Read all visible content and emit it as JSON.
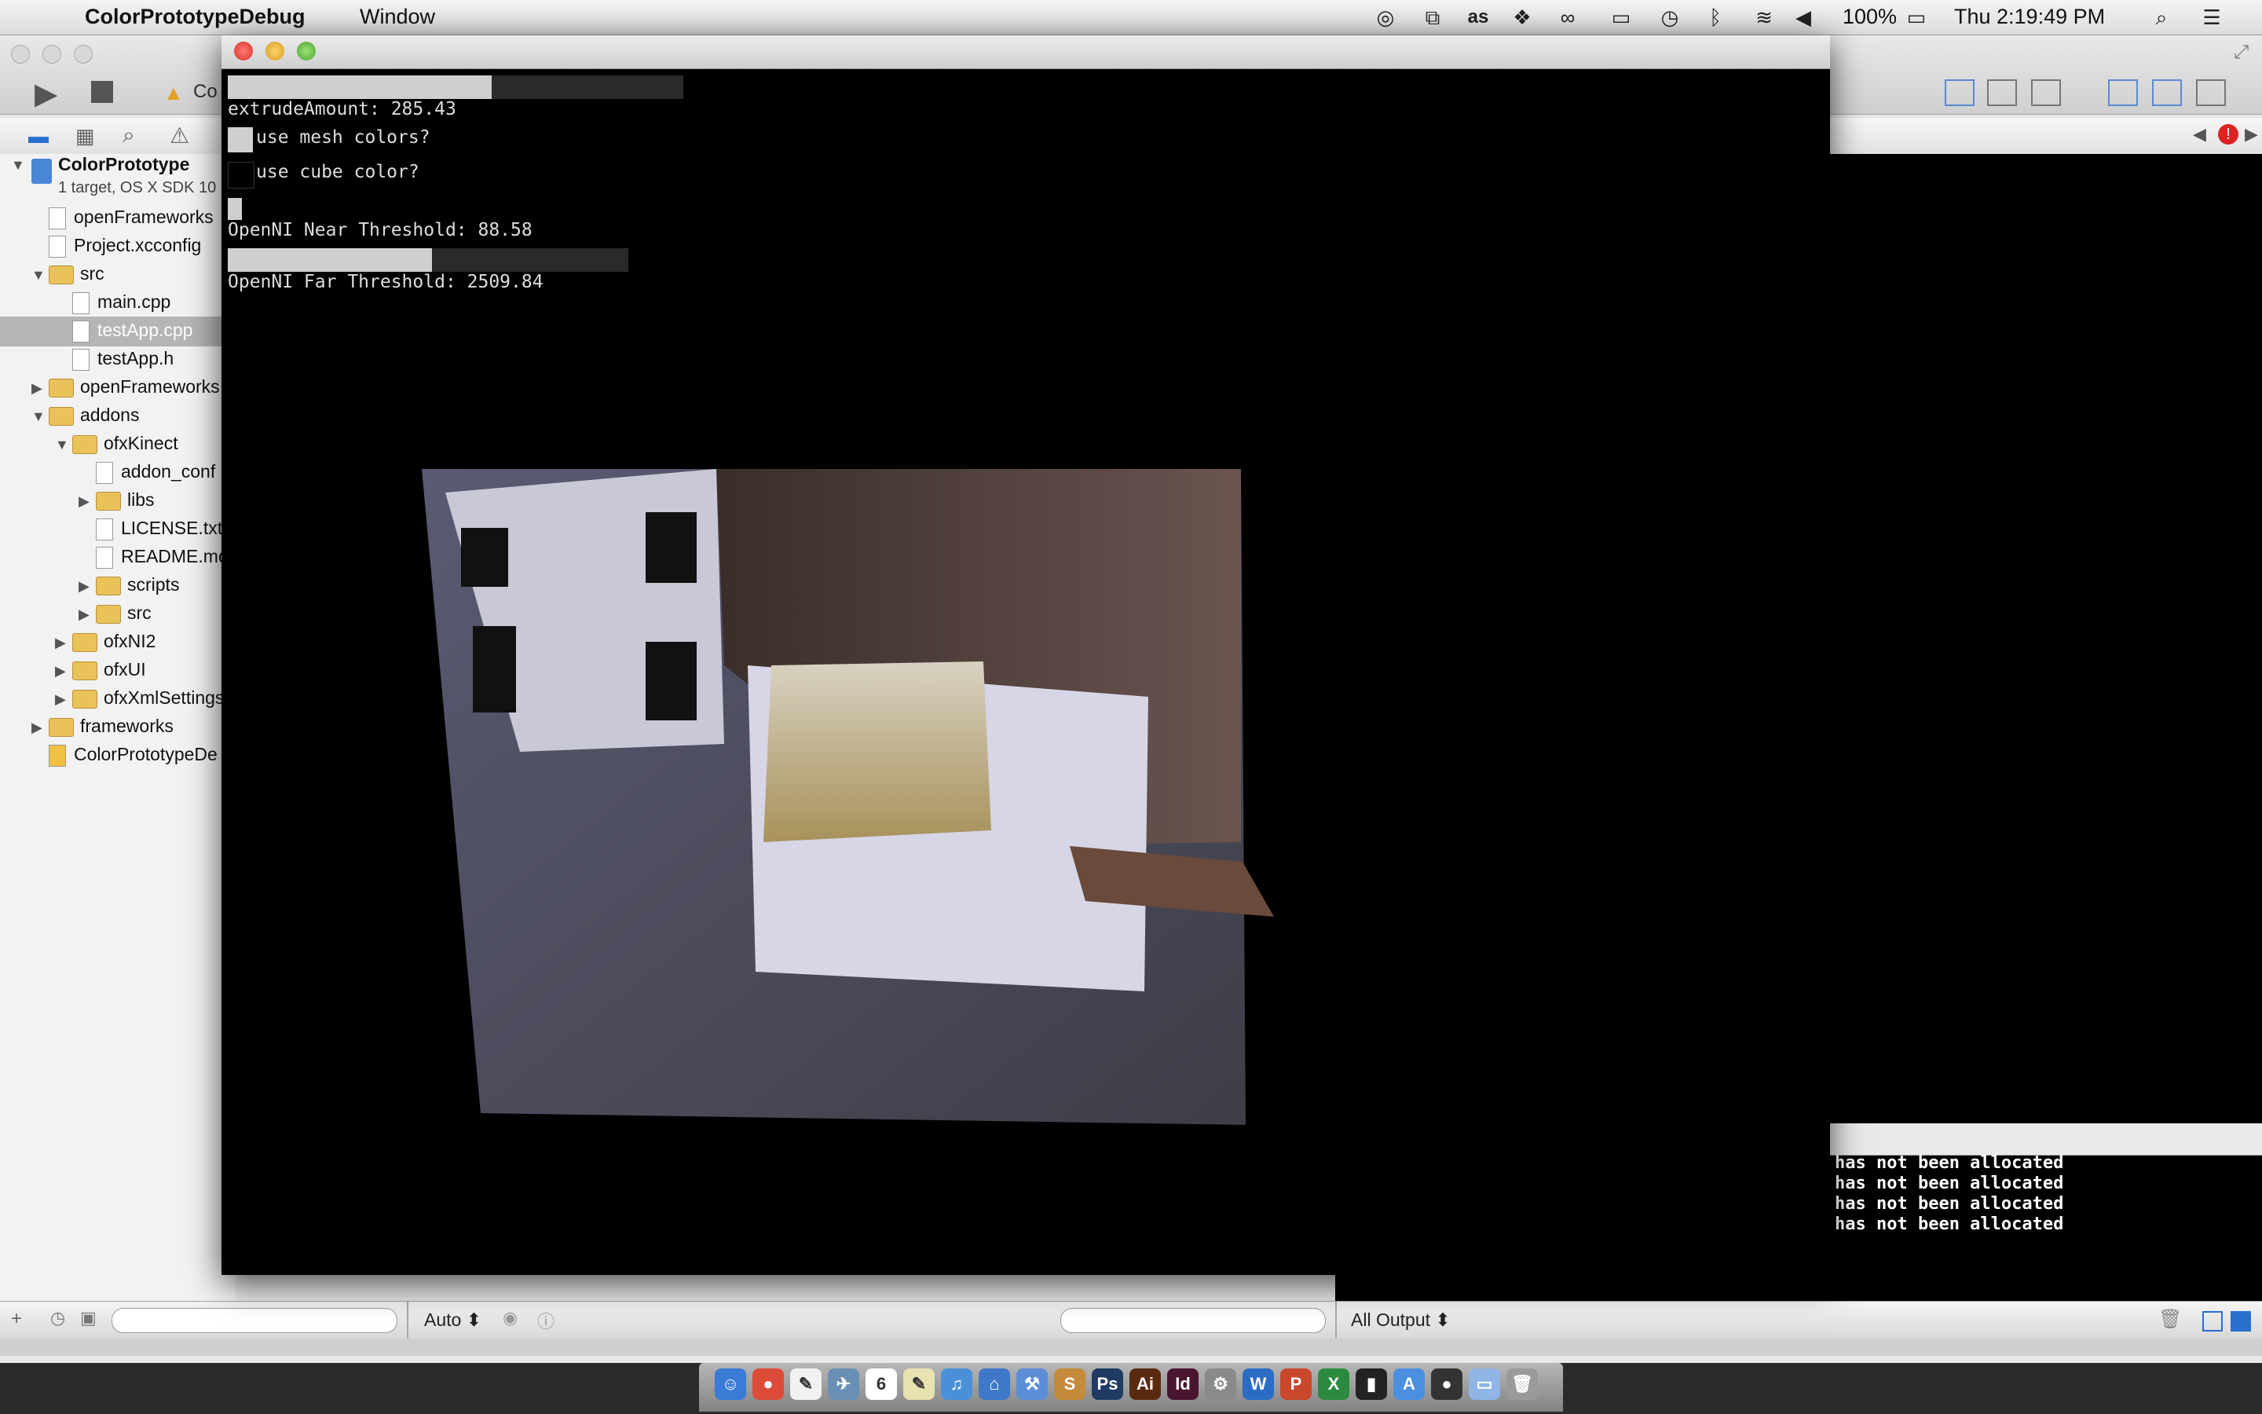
{
  "menubar": {
    "app_name": "ColorPrototypeDebug",
    "menu_window": "Window",
    "battery": "100%",
    "clock": "Thu 2:19:49 PM"
  },
  "xcode": {
    "scheme_partial": "Co",
    "project_name": "ColorPrototype",
    "project_sub": "1 target, OS X SDK 10",
    "tree": [
      {
        "label": "openFrameworks",
        "kind": "file",
        "disc": ""
      },
      {
        "label": "Project.xcconfig",
        "kind": "file",
        "disc": ""
      },
      {
        "label": "src",
        "kind": "folder",
        "disc": "▼"
      },
      {
        "label": "main.cpp",
        "kind": "file",
        "disc": ""
      },
      {
        "label": "testApp.cpp",
        "kind": "file",
        "disc": ""
      },
      {
        "label": "testApp.h",
        "kind": "file",
        "disc": ""
      },
      {
        "label": "openFrameworks",
        "kind": "folder",
        "disc": "▶"
      },
      {
        "label": "addons",
        "kind": "folder",
        "disc": "▼"
      },
      {
        "label": "ofxKinect",
        "kind": "folder",
        "disc": "▼"
      },
      {
        "label": "addon_conf",
        "kind": "file",
        "disc": ""
      },
      {
        "label": "libs",
        "kind": "folder",
        "disc": "▶"
      },
      {
        "label": "LICENSE.txt",
        "kind": "file",
        "disc": ""
      },
      {
        "label": "README.md",
        "kind": "file",
        "disc": ""
      },
      {
        "label": "scripts",
        "kind": "folder",
        "disc": "▶"
      },
      {
        "label": "src",
        "kind": "folder",
        "disc": "▶"
      },
      {
        "label": "ofxNI2",
        "kind": "folder",
        "disc": "▶"
      },
      {
        "label": "ofxUI",
        "kind": "folder",
        "disc": "▶"
      },
      {
        "label": "ofxXmlSettings",
        "kind": "folder",
        "disc": "▶"
      },
      {
        "label": "frameworks",
        "kind": "folder",
        "disc": "▶"
      },
      {
        "label": "ColorPrototypeDe",
        "kind": "app",
        "disc": ""
      }
    ],
    "bottom": {
      "auto_label": "Auto ⬍",
      "output_label": "All Output ⬍"
    },
    "console_lines": [
      "has not been allocated",
      "has not been allocated",
      "has not been allocated",
      "has not been allocated"
    ]
  },
  "of_gui": {
    "extrude_label": "extrudeAmount: 285.43",
    "extrude_fill": 0.58,
    "toggle_mesh_label": "use mesh colors?",
    "toggle_mesh_on": true,
    "toggle_cube_label": "use cube color?",
    "toggle_cube_on": false,
    "near_label": "OpenNI Near Threshold: 88.58",
    "far_label": "OpenNI Far Threshold: 2509.84",
    "far_fill": 0.51
  },
  "dock": {
    "icons": [
      "finder-icon",
      "chrome-icon",
      "notes-icon",
      "preview-icon",
      "calendar-icon",
      "notepad-icon",
      "itunes-icon",
      "keynote-icon",
      "xcode-icon",
      "sublime-icon",
      "photoshop-icon",
      "illustrator-icon",
      "indesign-icon",
      "utility-icon",
      "word-icon",
      "powerpoint-icon",
      "excel-icon",
      "terminal-icon",
      "appstore-icon",
      "camera-icon",
      "folder-icon",
      "trash-icon"
    ],
    "icon_letters": [
      "☺",
      "●",
      "✎",
      "✈",
      "6",
      "✎",
      "♫",
      "⌂",
      "⚒",
      "S",
      "Ps",
      "Ai",
      "Id",
      "⚙",
      "W",
      "P",
      "X",
      "▮",
      "A",
      "●",
      "▭",
      "🗑"
    ],
    "colors": [
      "#3a7bd5",
      "#dd4b39",
      "#f1f1f1",
      "#6a8fb5",
      "#ffffff",
      "#e8e2b0",
      "#4a90d9",
      "#3f78c8",
      "#5c8ed8",
      "#c58a3a",
      "#1f3b64",
      "#5a2a10",
      "#4a1530",
      "#8a8a8a",
      "#2b6cc4",
      "#c9472b",
      "#2b8a3e",
      "#222222",
      "#4b8fe0",
      "#333333",
      "#8fb4e6",
      "#9a9a9a"
    ]
  }
}
